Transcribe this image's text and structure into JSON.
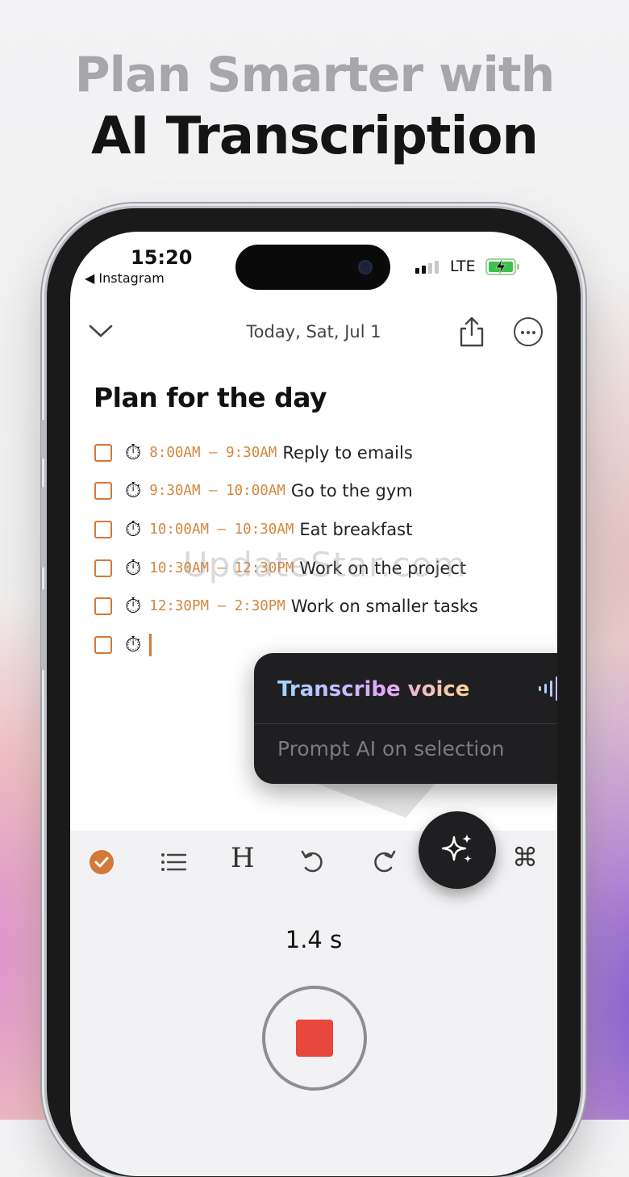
{
  "headline": {
    "line1": "Plan Smarter with",
    "line2": "AI Transcription"
  },
  "status_bar": {
    "time": "15:20",
    "back_app": "◀ Instagram",
    "network": "LTE"
  },
  "nav": {
    "date": "Today, Sat, Jul 1"
  },
  "note": {
    "title": "Plan for the day",
    "tasks": [
      {
        "time": "8:00AM – 9:30AM",
        "text": "Reply to emails"
      },
      {
        "time": "9:30AM – 10:00AM",
        "text": "Go to the gym"
      },
      {
        "time": "10:00AM – 10:30AM",
        "text": "Eat breakfast"
      },
      {
        "time": "10:30AM – 12:30PM",
        "text": "Work on the project"
      },
      {
        "time": "12:30PM – 2:30PM",
        "text": "Work on smaller tasks"
      }
    ]
  },
  "watermark": "UpdateStar.com",
  "ai_menu": {
    "transcribe_label": "Transcribe voice",
    "prompt_label": "Prompt AI on selection"
  },
  "toolbar": {
    "items": [
      "checkbox-icon",
      "list-icon",
      "heading-icon",
      "undo-icon",
      "redo-icon",
      "sparkle-icon",
      "command-icon"
    ],
    "heading_glyph": "H",
    "command_glyph": "⌘"
  },
  "recorder": {
    "duration": "1.4 s"
  },
  "colors": {
    "accent": "#d4783a",
    "stop": "#e8473b",
    "popover": "#1f1f21"
  }
}
